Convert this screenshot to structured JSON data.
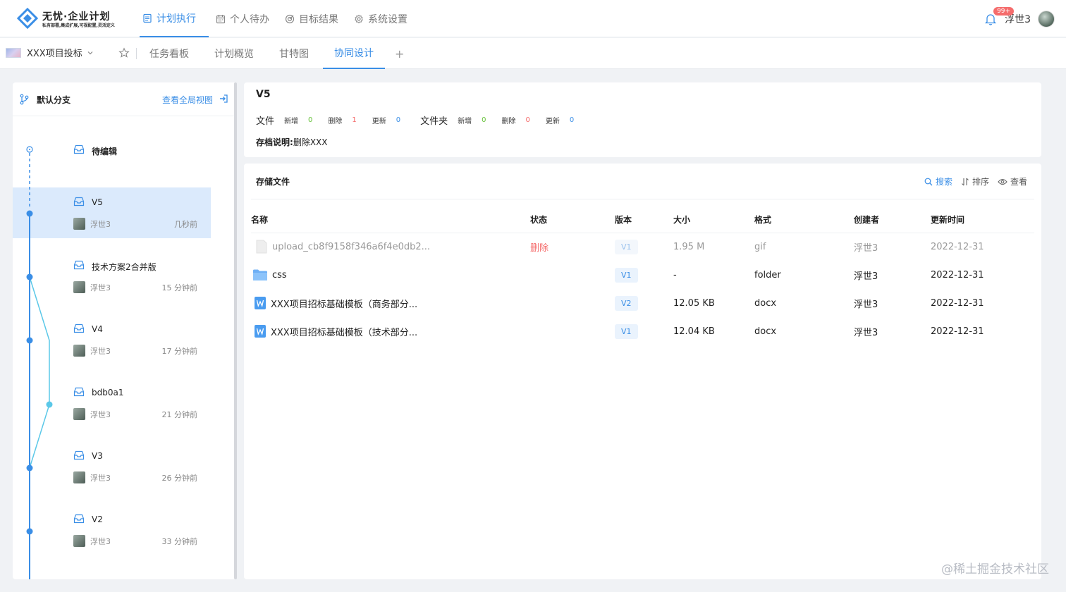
{
  "header": {
    "logo_title": "无忧·企业计划",
    "logo_subtitle": "私有部署,集成扩展,可视配置,灵活定义",
    "nav": [
      {
        "label": "计划执行",
        "icon": "calendar-list-icon",
        "active": true
      },
      {
        "label": "个人待办",
        "icon": "calendar-icon",
        "active": false
      },
      {
        "label": "目标结果",
        "icon": "target-icon",
        "active": false
      },
      {
        "label": "系统设置",
        "icon": "gear-icon",
        "active": false
      }
    ],
    "notification_badge": "99+",
    "username": "浮世3"
  },
  "subbar": {
    "project_name": "XXX项目投标",
    "tabs": [
      {
        "label": "任务看板",
        "active": false
      },
      {
        "label": "计划概览",
        "active": false
      },
      {
        "label": "甘特图",
        "active": false
      },
      {
        "label": "协同设计",
        "active": true
      }
    ],
    "add_tab": "+"
  },
  "branch_panel": {
    "branch_label": "默认分支",
    "global_view_link": "查看全局视图",
    "items": [
      {
        "title": "待编辑",
        "author": "",
        "time": "",
        "selected": false
      },
      {
        "title": "V5",
        "author": "浮世3",
        "time": "几秒前",
        "selected": true
      },
      {
        "title": "技术方案2合并版",
        "author": "浮世3",
        "time": "15 分钟前",
        "selected": false
      },
      {
        "title": "V4",
        "author": "浮世3",
        "time": "17 分钟前",
        "selected": false
      },
      {
        "title": "bdb0a1",
        "author": "浮世3",
        "time": "21 分钟前",
        "selected": false
      },
      {
        "title": "V3",
        "author": "浮世3",
        "time": "26 分钟前",
        "selected": false
      },
      {
        "title": "V2",
        "author": "浮世3",
        "time": "33 分钟前",
        "selected": false
      }
    ]
  },
  "version_detail": {
    "title": "V5",
    "file_label": "文件",
    "folder_label": "文件夹",
    "added_label": "新增",
    "deleted_label": "删除",
    "updated_label": "更新",
    "file_added": "0",
    "file_deleted": "1",
    "file_updated": "0",
    "folder_added": "0",
    "folder_deleted": "0",
    "folder_updated": "0",
    "note_label": "存档说明:",
    "note_value": "删除XXX"
  },
  "files": {
    "title": "存储文件",
    "actions": {
      "search": "搜索",
      "sort": "排序",
      "view": "查看"
    },
    "columns": [
      "名称",
      "状态",
      "版本",
      "大小",
      "格式",
      "创建者",
      "更新时间"
    ],
    "rows": [
      {
        "name": "upload_cb8f9158f346a6f4e0db2...",
        "status": "删除",
        "version": "V1",
        "size": "1.95 M",
        "format": "gif",
        "creator": "浮世3",
        "updated": "2022-12-31",
        "icon": "generic-file-icon"
      },
      {
        "name": "css",
        "status": "",
        "version": "V1",
        "size": "-",
        "format": "folder",
        "creator": "浮世3",
        "updated": "2022-12-31",
        "icon": "folder-icon"
      },
      {
        "name": "XXX项目招标基础模板（商务部分...",
        "status": "",
        "version": "V2",
        "size": "12.05 KB",
        "format": "docx",
        "creator": "浮世3",
        "updated": "2022-12-31",
        "icon": "word-doc-icon"
      },
      {
        "name": "XXX项目招标基础模板（技术部分...",
        "status": "",
        "version": "V1",
        "size": "12.04 KB",
        "format": "docx",
        "creator": "浮世3",
        "updated": "2022-12-31",
        "icon": "word-doc-icon"
      }
    ]
  },
  "watermark": "@稀土掘金技术社区",
  "colors": {
    "accent": "#3a8ee6",
    "danger": "#f56c6c",
    "success": "#67c23a",
    "timeline": "#5bc8e8",
    "selected_bg": "#dbeafc"
  }
}
